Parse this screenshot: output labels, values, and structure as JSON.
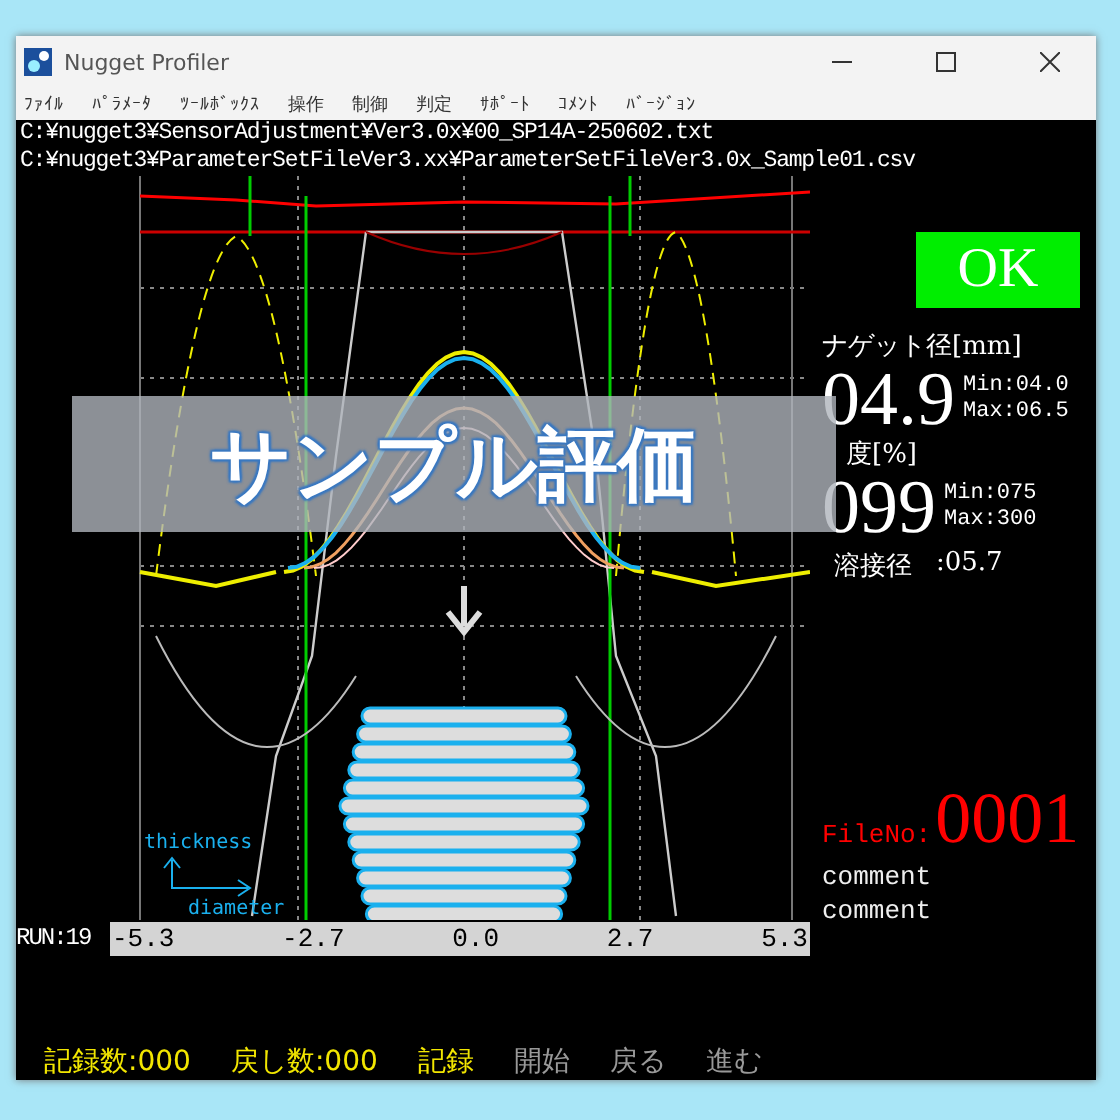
{
  "window": {
    "title": "Nugget Profiler"
  },
  "menu": [
    "ﾌｧｲﾙ",
    "ﾊﾟﾗﾒｰﾀ",
    "ﾂｰﾙﾎﾞｯｸｽ",
    "操作",
    "制御",
    "判定",
    "ｻﾎﾟｰﾄ",
    "ｺﾒﾝﾄ",
    "ﾊﾞｰｼﾞｮﾝ"
  ],
  "paths": [
    "C:¥nugget3¥SensorAdjustment¥Ver3.0x¥00_SP14A-250602.txt",
    "C:¥nugget3¥ParameterSetFileVer3.xx¥ParameterSetFileVer3.0x_Sample01.csv"
  ],
  "legend": {
    "y_label": "thickness",
    "x_label": "diameter"
  },
  "axis": {
    "run": "RUN:19",
    "ticks": [
      "-5.3",
      "-2.7",
      "0.0",
      "2.7",
      "5.3"
    ]
  },
  "result": {
    "judgement": "OK",
    "nugget_label": "ナゲット径[mm]",
    "nugget_value": "04.9",
    "nugget_min": "Min:04.0",
    "nugget_max": "Max:06.5",
    "second_label": "度[%]",
    "second_value": "099",
    "second_min": "Min:075",
    "second_max": "Max:300",
    "weld_label": "溶接径",
    "weld_value": ":05.7"
  },
  "file": {
    "label": "FileNo:",
    "number": "0001"
  },
  "comments": [
    "comment",
    "comment"
  ],
  "banner": "サンプル評価",
  "controls": [
    {
      "kind": "counter",
      "label": "記録数:000",
      "disabled": false
    },
    {
      "kind": "counter",
      "label": "戻し数:000",
      "disabled": false
    },
    {
      "kind": "button",
      "label": "記録",
      "disabled": false
    },
    {
      "kind": "button",
      "label": "開始",
      "disabled": true
    },
    {
      "kind": "button",
      "label": "戻る",
      "disabled": true
    },
    {
      "kind": "button",
      "label": "進む",
      "disabled": true
    }
  ]
}
